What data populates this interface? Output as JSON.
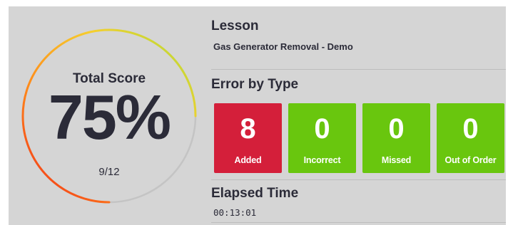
{
  "colors": {
    "panel": "#d5d5d5",
    "text": "#2b2b38",
    "error_red": "#d41f3a",
    "ok_green": "#69c60e",
    "gauge_track": "#c4c4c4",
    "gauge_gradient": [
      "#f02818",
      "#ff8a1a",
      "#f5cf2e",
      "#a6dd3a"
    ]
  },
  "score": {
    "title": "Total Score",
    "percent": 75,
    "percent_label": "75%",
    "fraction": "9/12"
  },
  "lesson": {
    "heading": "Lesson",
    "name": "Gas Generator Removal - Demo"
  },
  "errors": {
    "heading": "Error by Type",
    "tiles": [
      {
        "count": "8",
        "label": "Added",
        "status": "error"
      },
      {
        "count": "0",
        "label": "Incorrect",
        "status": "ok"
      },
      {
        "count": "0",
        "label": "Missed",
        "status": "ok"
      },
      {
        "count": "0",
        "label": "Out of Order",
        "status": "ok"
      }
    ]
  },
  "elapsed": {
    "heading": "Elapsed Time",
    "value": "00:13:01"
  }
}
